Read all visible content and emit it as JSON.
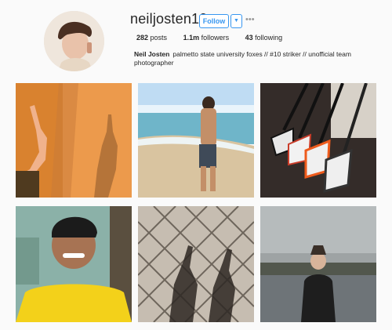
{
  "profile": {
    "username": "neiljosten10",
    "follow_label": "Follow",
    "dropdown_icon": "chevron-down-icon",
    "more_icon": "more-horizontal-icon",
    "stats": {
      "posts_count": "282",
      "posts_label": "posts",
      "followers_count": "1.1m",
      "followers_label": "followers",
      "following_count": "43",
      "following_label": "following"
    },
    "full_name": "Neil Josten",
    "bio": "palmetto state university foxes // #10 striker // unofficial team photographer"
  },
  "colors": {
    "accent": "#3897f0",
    "background": "#fafafa",
    "text": "#262626"
  }
}
